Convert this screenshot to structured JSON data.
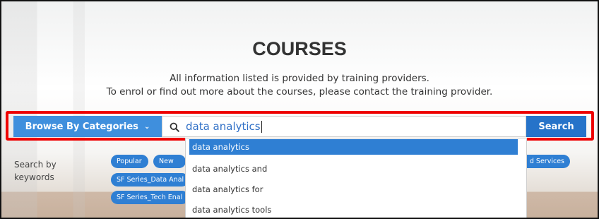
{
  "page": {
    "title": "COURSES",
    "info_line_1": "All information listed is provided by training providers.",
    "info_line_2": "To enrol or find out more about the courses, please contact the training provider."
  },
  "search": {
    "browse_label": "Browse By Categories",
    "browse_chevron": "⌄",
    "value": "data analytics",
    "button_label": "Search",
    "search_icon": "search-icon"
  },
  "keywords": {
    "label_line_1": "Search by",
    "label_line_2": "keywords",
    "tags": [
      "Popular",
      "New",
      "SF Series_Data Anal",
      "SF Series_Tech Enal",
      "d Services"
    ]
  },
  "suggestions": [
    "data analytics",
    "data analytics and",
    "data analytics for",
    "data analytics tools"
  ],
  "colors": {
    "primary": "#2f7fd3",
    "browse": "#3f8fdd",
    "search_button": "#2673c9",
    "highlight": "#ee0000"
  }
}
